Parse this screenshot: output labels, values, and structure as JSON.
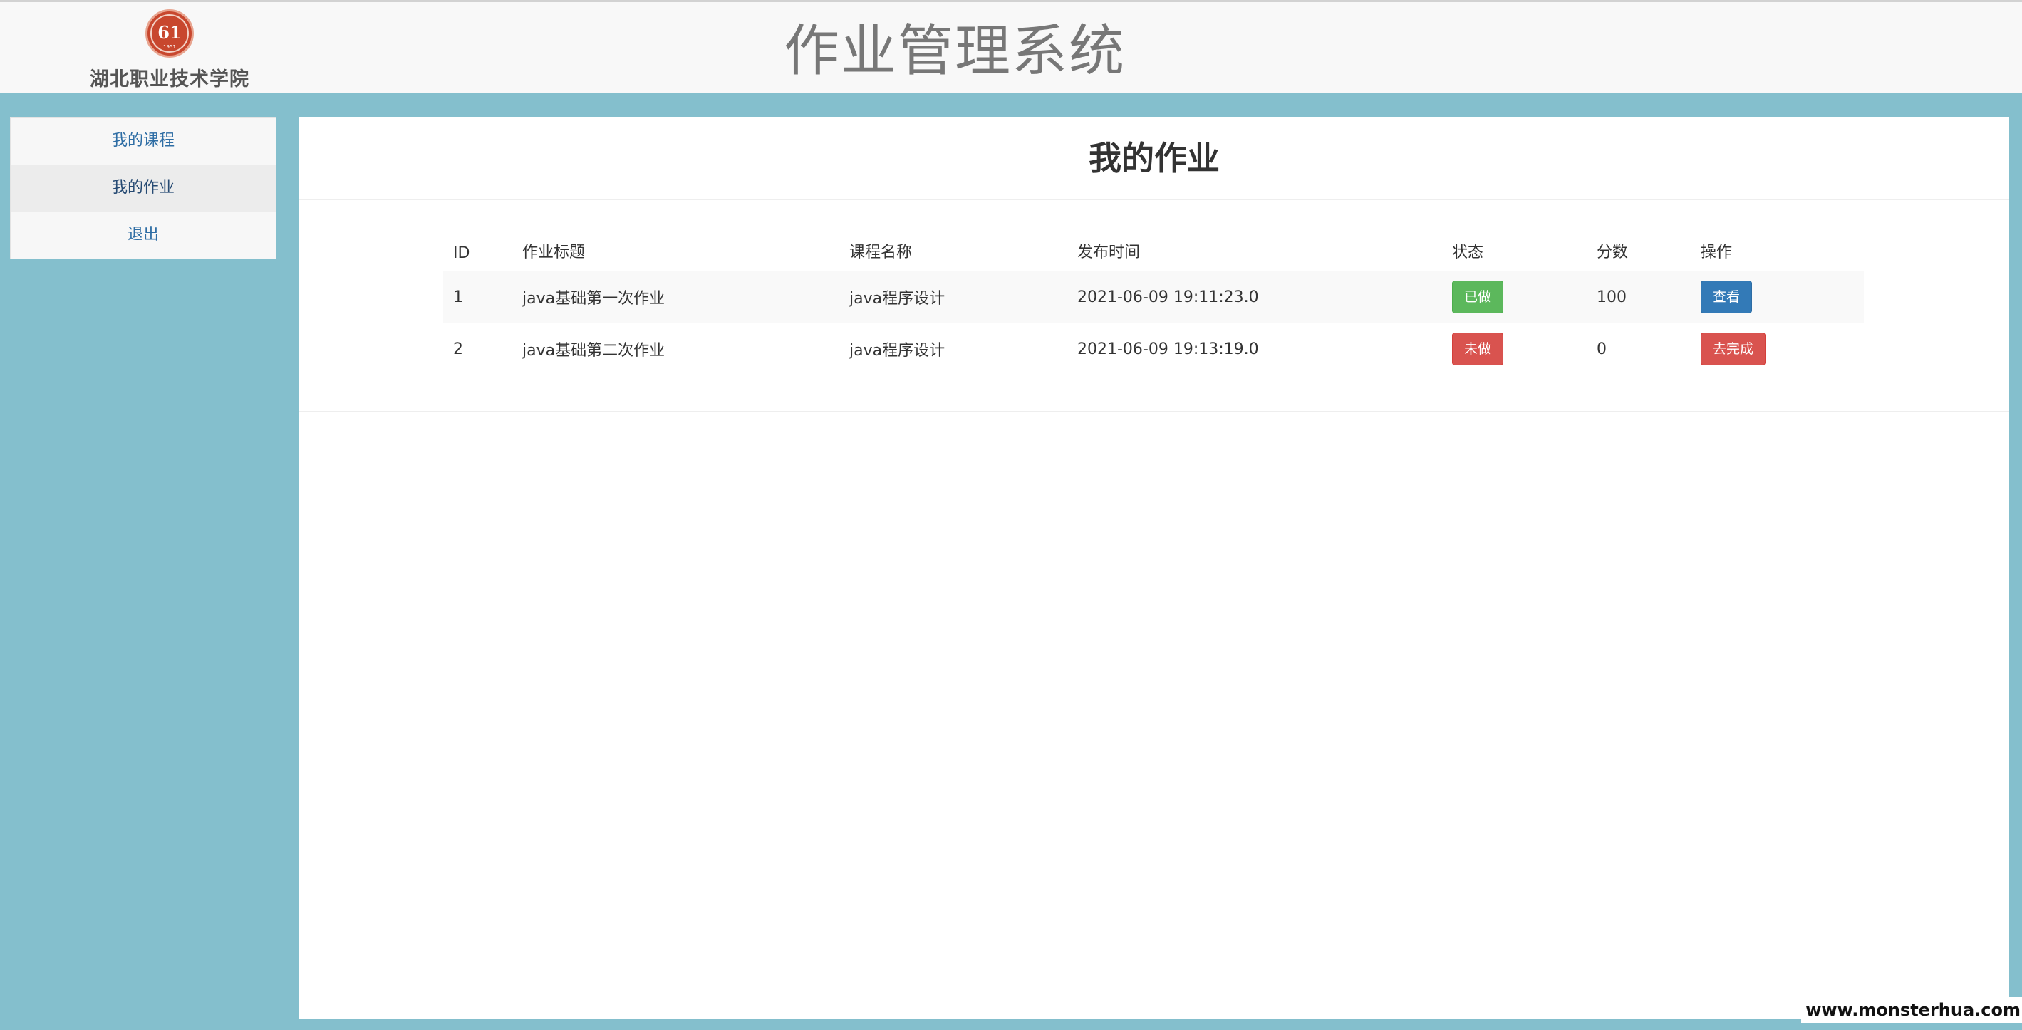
{
  "header": {
    "school_name": "湖北职业技术学院",
    "app_title": "作业管理系统",
    "logo": {
      "icon": "school-seal-icon",
      "seal_number": "61",
      "seal_year": "1951"
    }
  },
  "sidebar": {
    "items": [
      {
        "label": "我的课程",
        "active": false
      },
      {
        "label": "我的作业",
        "active": true
      },
      {
        "label": "退出",
        "active": false
      }
    ]
  },
  "main": {
    "title": "我的作业",
    "table": {
      "headers": [
        "ID",
        "作业标题",
        "课程名称",
        "发布时间",
        "状态",
        "分数",
        "操作"
      ],
      "rows": [
        {
          "id": "1",
          "title": "java基础第一次作业",
          "course": "java程序设计",
          "time": "2021-06-09 19:11:23.0",
          "status": "已做",
          "status_color": "#5cb85c",
          "score": "100",
          "action": "查看",
          "action_color": "#337ab7"
        },
        {
          "id": "2",
          "title": "java基础第二次作业",
          "course": "java程序设计",
          "time": "2021-06-09 19:13:19.0",
          "status": "未做",
          "status_color": "#d9534f",
          "score": "0",
          "action": "去完成",
          "action_color": "#d9534f"
        }
      ]
    }
  },
  "watermark": "www.monsterhua.com",
  "colors": {
    "page_bg": "#84bfcd",
    "header_bg": "#f8f8f8",
    "link": "#2e6da4"
  }
}
